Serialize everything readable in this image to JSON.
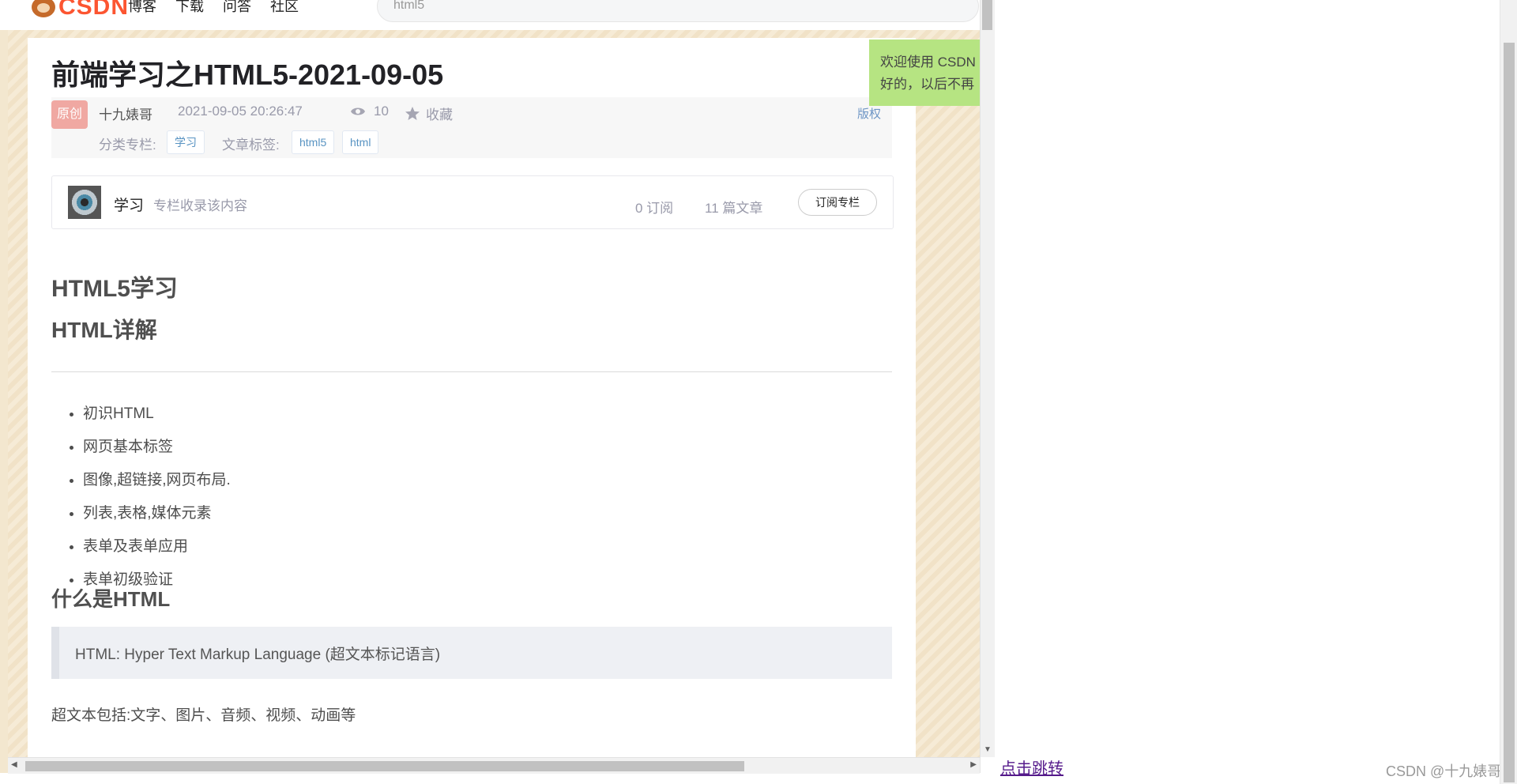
{
  "header": {
    "logo_text": "CSDN",
    "nav": [
      "博客",
      "下载",
      "问答",
      "社区"
    ],
    "search_value": "html5"
  },
  "article": {
    "title": "前端学习之HTML5-2021-09-05",
    "badge": "原创",
    "author": "十九婊哥",
    "date": "2021-09-05 20:26:47",
    "views": "10",
    "favorite": "收藏",
    "copyright": "版权",
    "category_label": "分类专栏:",
    "category_tag": "学习",
    "tags_label": "文章标签:",
    "tags": [
      "html5",
      "html"
    ]
  },
  "column": {
    "name": "学习",
    "desc": "专栏收录该内容",
    "subscribers": "0 订阅",
    "articles": "11 篇文章",
    "subscribe_button": "订阅专栏"
  },
  "content": {
    "h1": "HTML5学习",
    "h2": "HTML详解",
    "bullets": [
      "初识HTML",
      "网页基本标签",
      "图像,超链接,网页布局.",
      "列表,表格,媒体元素",
      "表单及表单应用",
      "表单初级验证"
    ],
    "h3": "什么是HTML",
    "quote": "HTML: Hyper Text Markup Language (超文本标记语言)",
    "para": "超文本包括:文字、图片、音频、视频、动画等"
  },
  "notice": {
    "line1": "欢迎使用 CSDN",
    "line2": "好的，以后不再"
  },
  "outer": {
    "jump_link": "点击跳转",
    "watermark": "CSDN @十九婊哥"
  },
  "colors": {
    "brand": "#fc5531",
    "notice_bg": "#b6e482",
    "badge_bg": "#f0a8a2",
    "link": "#551a8b"
  }
}
